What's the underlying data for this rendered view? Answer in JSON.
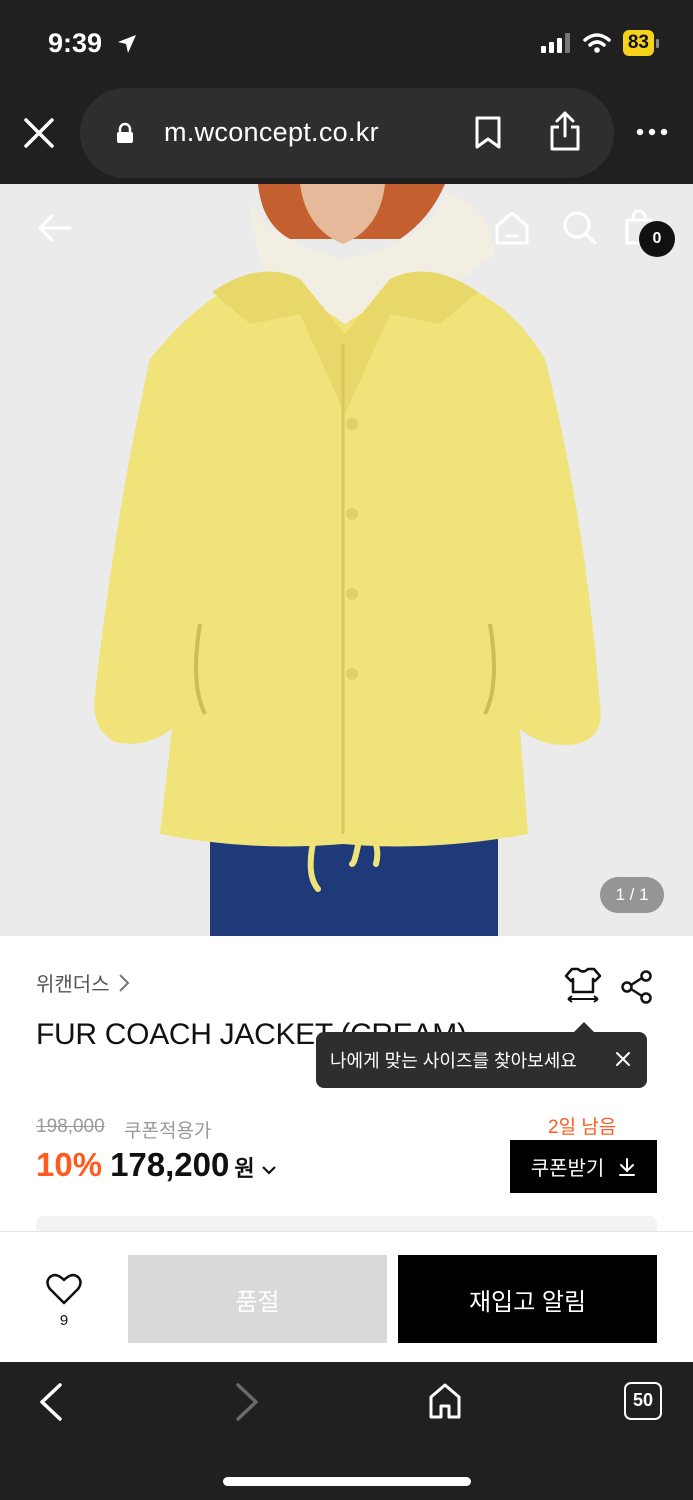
{
  "status_bar": {
    "time": "9:39",
    "battery": "83"
  },
  "browser": {
    "url": "m.wconcept.co.kr",
    "tabs_count": "50"
  },
  "header": {
    "cart_count": "0"
  },
  "gallery": {
    "page_indicator": "1 / 1"
  },
  "product": {
    "brand": "위캔더스",
    "title": "FUR COACH JACKET (CREAM)",
    "original_price": "198,000",
    "coupon_label": "쿠폰적용가",
    "discount": "10%",
    "price": "178,200",
    "currency": "원",
    "days_left": "2일 남음",
    "coupon_button": "쿠폰받기"
  },
  "tooltip": {
    "text": "나에게 맞는 사이즈를 찾아보세요"
  },
  "actions": {
    "like_count": "9",
    "soldout": "품절",
    "restock": "재입고 알림"
  },
  "colors": {
    "accent": "#ff5a1f",
    "dark": "#202020",
    "jacket": "#f0e37a"
  }
}
